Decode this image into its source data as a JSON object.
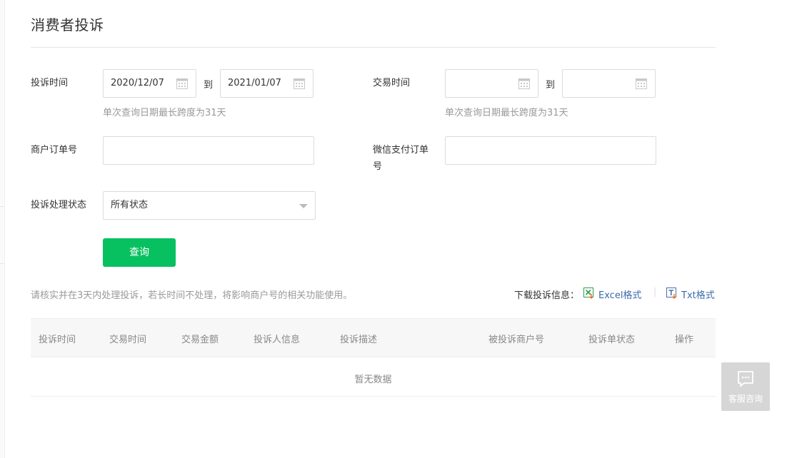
{
  "page": {
    "title": "消费者投诉"
  },
  "filters": {
    "complaint_time": {
      "label": "投诉时间",
      "start": "2020/12/07",
      "end": "2021/01/07",
      "to": "到",
      "hint": "单次查询日期最长跨度为31天"
    },
    "trade_time": {
      "label": "交易时间",
      "start": "",
      "end": "",
      "to": "到",
      "hint": "单次查询日期最长跨度为31天"
    },
    "merchant_order_no": {
      "label": "商户订单号",
      "value": ""
    },
    "wechat_order_no": {
      "label_line1": "微信支付订单",
      "label_line2": "号",
      "value": ""
    },
    "status": {
      "label": "投诉处理状态",
      "selected": "所有状态"
    },
    "query_button": "查询"
  },
  "notice": "请核实并在3天内处理投诉，若长时间不处理，将影响商户号的相关功能使用。",
  "download": {
    "label": "下载投诉信息：",
    "excel": "Excel格式",
    "separator": "|",
    "txt": "Txt格式"
  },
  "table": {
    "columns": [
      "投诉时间",
      "交易时间",
      "交易金额",
      "投诉人信息",
      "投诉描述",
      "被投诉商户号",
      "投诉单状态",
      "操作"
    ],
    "empty_text": "暂无数据"
  },
  "support": {
    "label": "客服咨询",
    "icon": "chat-bubble-icon"
  },
  "colors": {
    "primary_button": "#07c160",
    "link": "#3d6aa8"
  }
}
